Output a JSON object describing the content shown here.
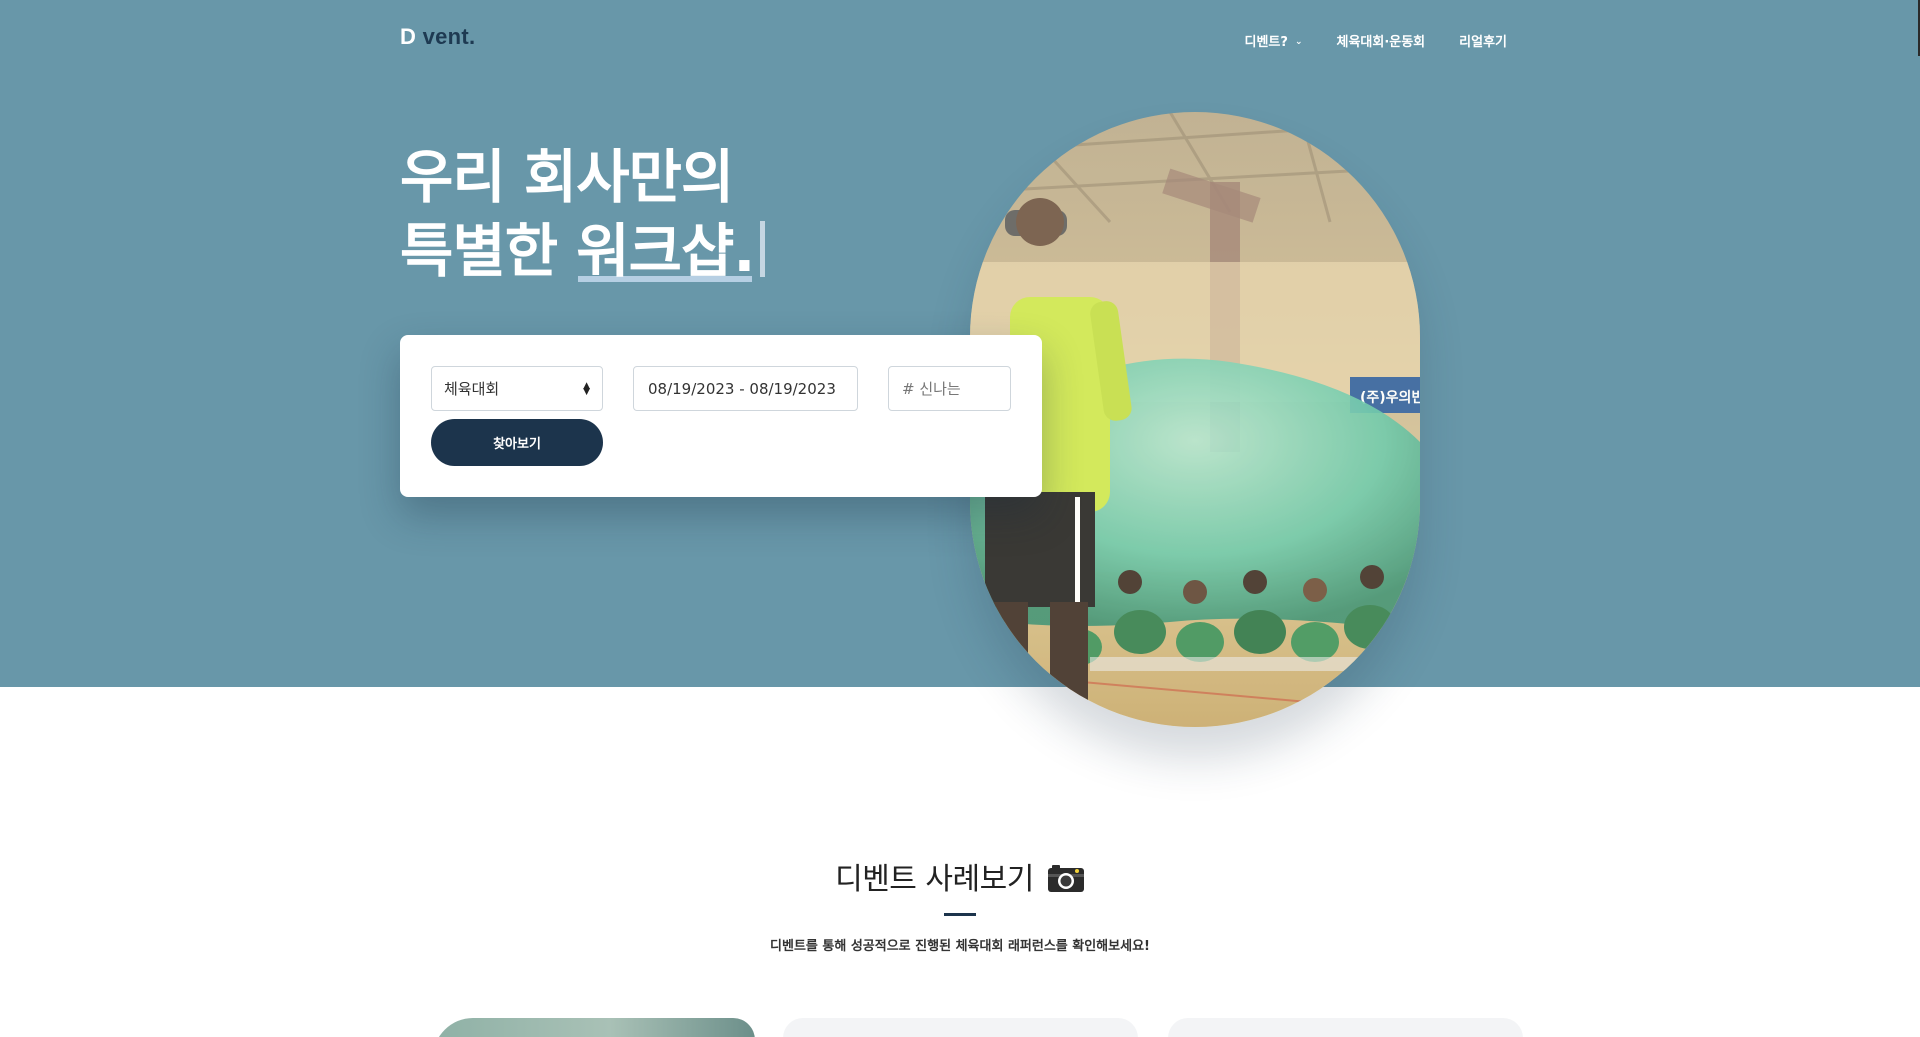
{
  "brand": {
    "first": "D",
    "rest": " vent."
  },
  "nav": {
    "items": [
      {
        "label": "디벤트?"
      },
      {
        "label": "체육대회·운동회"
      },
      {
        "label": "리얼후기"
      }
    ]
  },
  "hero": {
    "line1": "우리 회사만의",
    "line2_prefix": "특별한 ",
    "line2_highlight": "워크샵."
  },
  "search": {
    "category": "체육대회",
    "date_range": "08/19/2023 - 08/19/2023",
    "tag_placeholder": "# 신나는",
    "button": "찾아보기"
  },
  "photo_banner": "(주)우의빈",
  "cases": {
    "title": "디벤트 사례보기",
    "subtitle": "디벤트를 통해 성공적으로 진행된 체육대회 래퍼런스를 확인해보세요!"
  },
  "colors": {
    "hero_bg": "#6897a9",
    "dark_navy": "#1c344c",
    "highlight": "#b6cfe3"
  }
}
